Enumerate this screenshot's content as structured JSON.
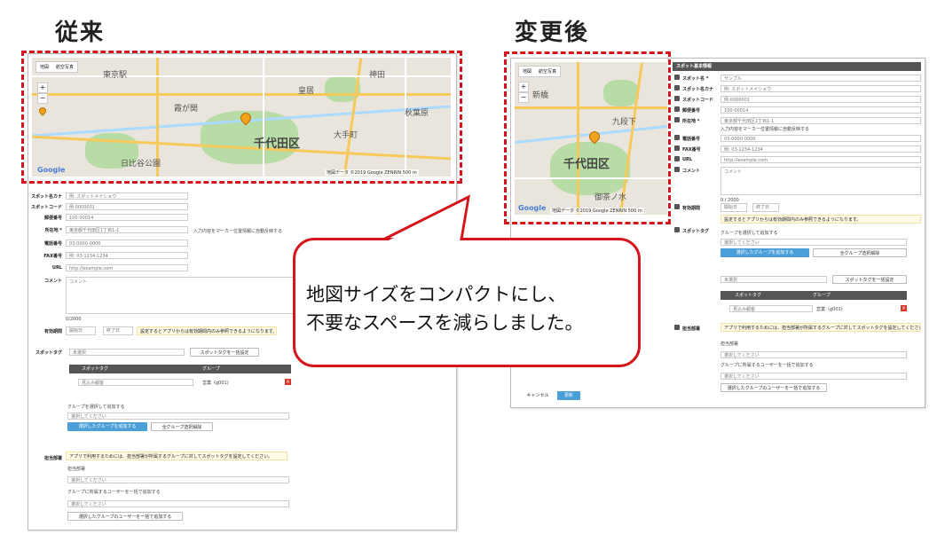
{
  "headings": {
    "before": "従来",
    "after": "変更後"
  },
  "callout": {
    "line1": "地図サイズをコンパクトにし、",
    "line2": "不要なスペースを減らしました。"
  },
  "map": {
    "type_map": "地図",
    "type_satellite": "航空写真",
    "district": "千代田区",
    "copyright": "地図データ ©2019 Google ZENRIN  500 m",
    "google_logo": "Google",
    "zoom_in": "+",
    "zoom_out": "−",
    "labels": [
      "東京駅",
      "皇居",
      "日比谷公園",
      "神田",
      "秋葉原",
      "霞が関",
      "大手町",
      "新橋",
      "九段下",
      "御茶ノ水"
    ]
  },
  "before": {
    "fields": [
      {
        "label": "スポット名カナ",
        "value": "例: スポットメイショウ"
      },
      {
        "label": "スポットコード",
        "value": "例:0000001"
      },
      {
        "label": "郵便番号",
        "value": "100-00014"
      },
      {
        "label": "所在地 *",
        "value": "東京都千代田区1丁目1-1"
      },
      {
        "label": "電話番号",
        "value": "03-0000-0000"
      },
      {
        "label": "FAX番号",
        "value": "例: 03-1234-1234"
      },
      {
        "label": "URL",
        "value": "http://example.com"
      },
      {
        "label": "コメント",
        "value": "コメント"
      }
    ],
    "address_note": "入力内容をマーカー位置情報に自動反映する",
    "comment_count": "0/2000",
    "validity_label": "有効期間",
    "start_placeholder": "開始日",
    "end_placeholder": "終了日",
    "validity_notice": "設定するとアプリからは有効期間内のみ参照できるようになります。",
    "spot_tag_label": "スポットタグ",
    "tag_select": "未選択",
    "tag_add_button": "スポットタグを一括設定",
    "tag_col": "スポットタグ",
    "group_col": "グループ",
    "tag_row_value": "見込み顧客",
    "tag_row_group": "営業（g001)",
    "group_select_hint": "グループを選択して追加する",
    "group_input_placeholder": "選択してください",
    "group_add_button": "選択したグループを追加する",
    "group_clear_button": "全グループ选択解除",
    "owner_label": "担当部署",
    "owner_notice": "アプリで利用するためには、担当部署が所属するグループに対してスポットタグを設定してください。",
    "owner_group": "担当部署",
    "owner_select": "選択してください",
    "owner_user_hint": "グループに所属するユーザーを一括で追加する",
    "owner_user_select": "選択してください",
    "owner_add_button": "選択したグループのユーザーを一括で追加する"
  },
  "after": {
    "panel_title": "スポット基本情報",
    "fields": [
      {
        "label": "スポット名 *",
        "value": "サンプル"
      },
      {
        "label": "スポット名カナ",
        "value": "例: スポットメイショウ"
      },
      {
        "label": "スポットコード",
        "value": "例:0000001"
      },
      {
        "label": "郵便番号",
        "value": "100-00014"
      },
      {
        "label": "所在地 *",
        "value": "東京都千代田区1丁目1-1"
      },
      {
        "label": "電話番号",
        "value": "03-0000-0000"
      },
      {
        "label": "FAX番号",
        "value": "例: 03-1234-1234"
      },
      {
        "label": "URL",
        "value": "http://example.com"
      },
      {
        "label": "コメント",
        "value": "コメント"
      }
    ],
    "address_note": "入力内容をマーカー位置情報に自動反映する",
    "comment_count": "0 / 2000",
    "validity_label": "有効期間",
    "start_placeholder": "開始日",
    "end_placeholder": "終了日",
    "validity_notice": "設定するとアプリからは有効期間内のみ参照できるようになります。",
    "spot_tag_label": "スポットタグ",
    "group_select_hint": "グループを選択して追加する",
    "group_input_placeholder": "選択してください",
    "group_add_button": "選択したグループを追加する",
    "group_clear_button": "全グループ选択解除",
    "tag_select": "未選択",
    "tag_add_button": "スポットタグを一括設定",
    "tag_col": "スポットタグ",
    "group_col": "グループ",
    "tag_row_value": "見込み顧客",
    "tag_row_group": "営業（g001)",
    "owner_label": "担当部署",
    "owner_notice": "アプリで利用するためには、担当部署が所属するグループに対してスポットタグを設定してください。",
    "owner_group": "担当部署",
    "owner_select": "選択してください",
    "owner_user_hint": "グループに所属するユーザーを一括で追加する",
    "owner_user_select": "選択してください",
    "owner_add_button": "選択したグループのユーザーを一括で追加する",
    "cancel_button": "キャンセル",
    "update_button": "更新"
  },
  "colors": {
    "dash": "#d4161c",
    "accent": "#4a9fd8",
    "header": "#555555"
  }
}
